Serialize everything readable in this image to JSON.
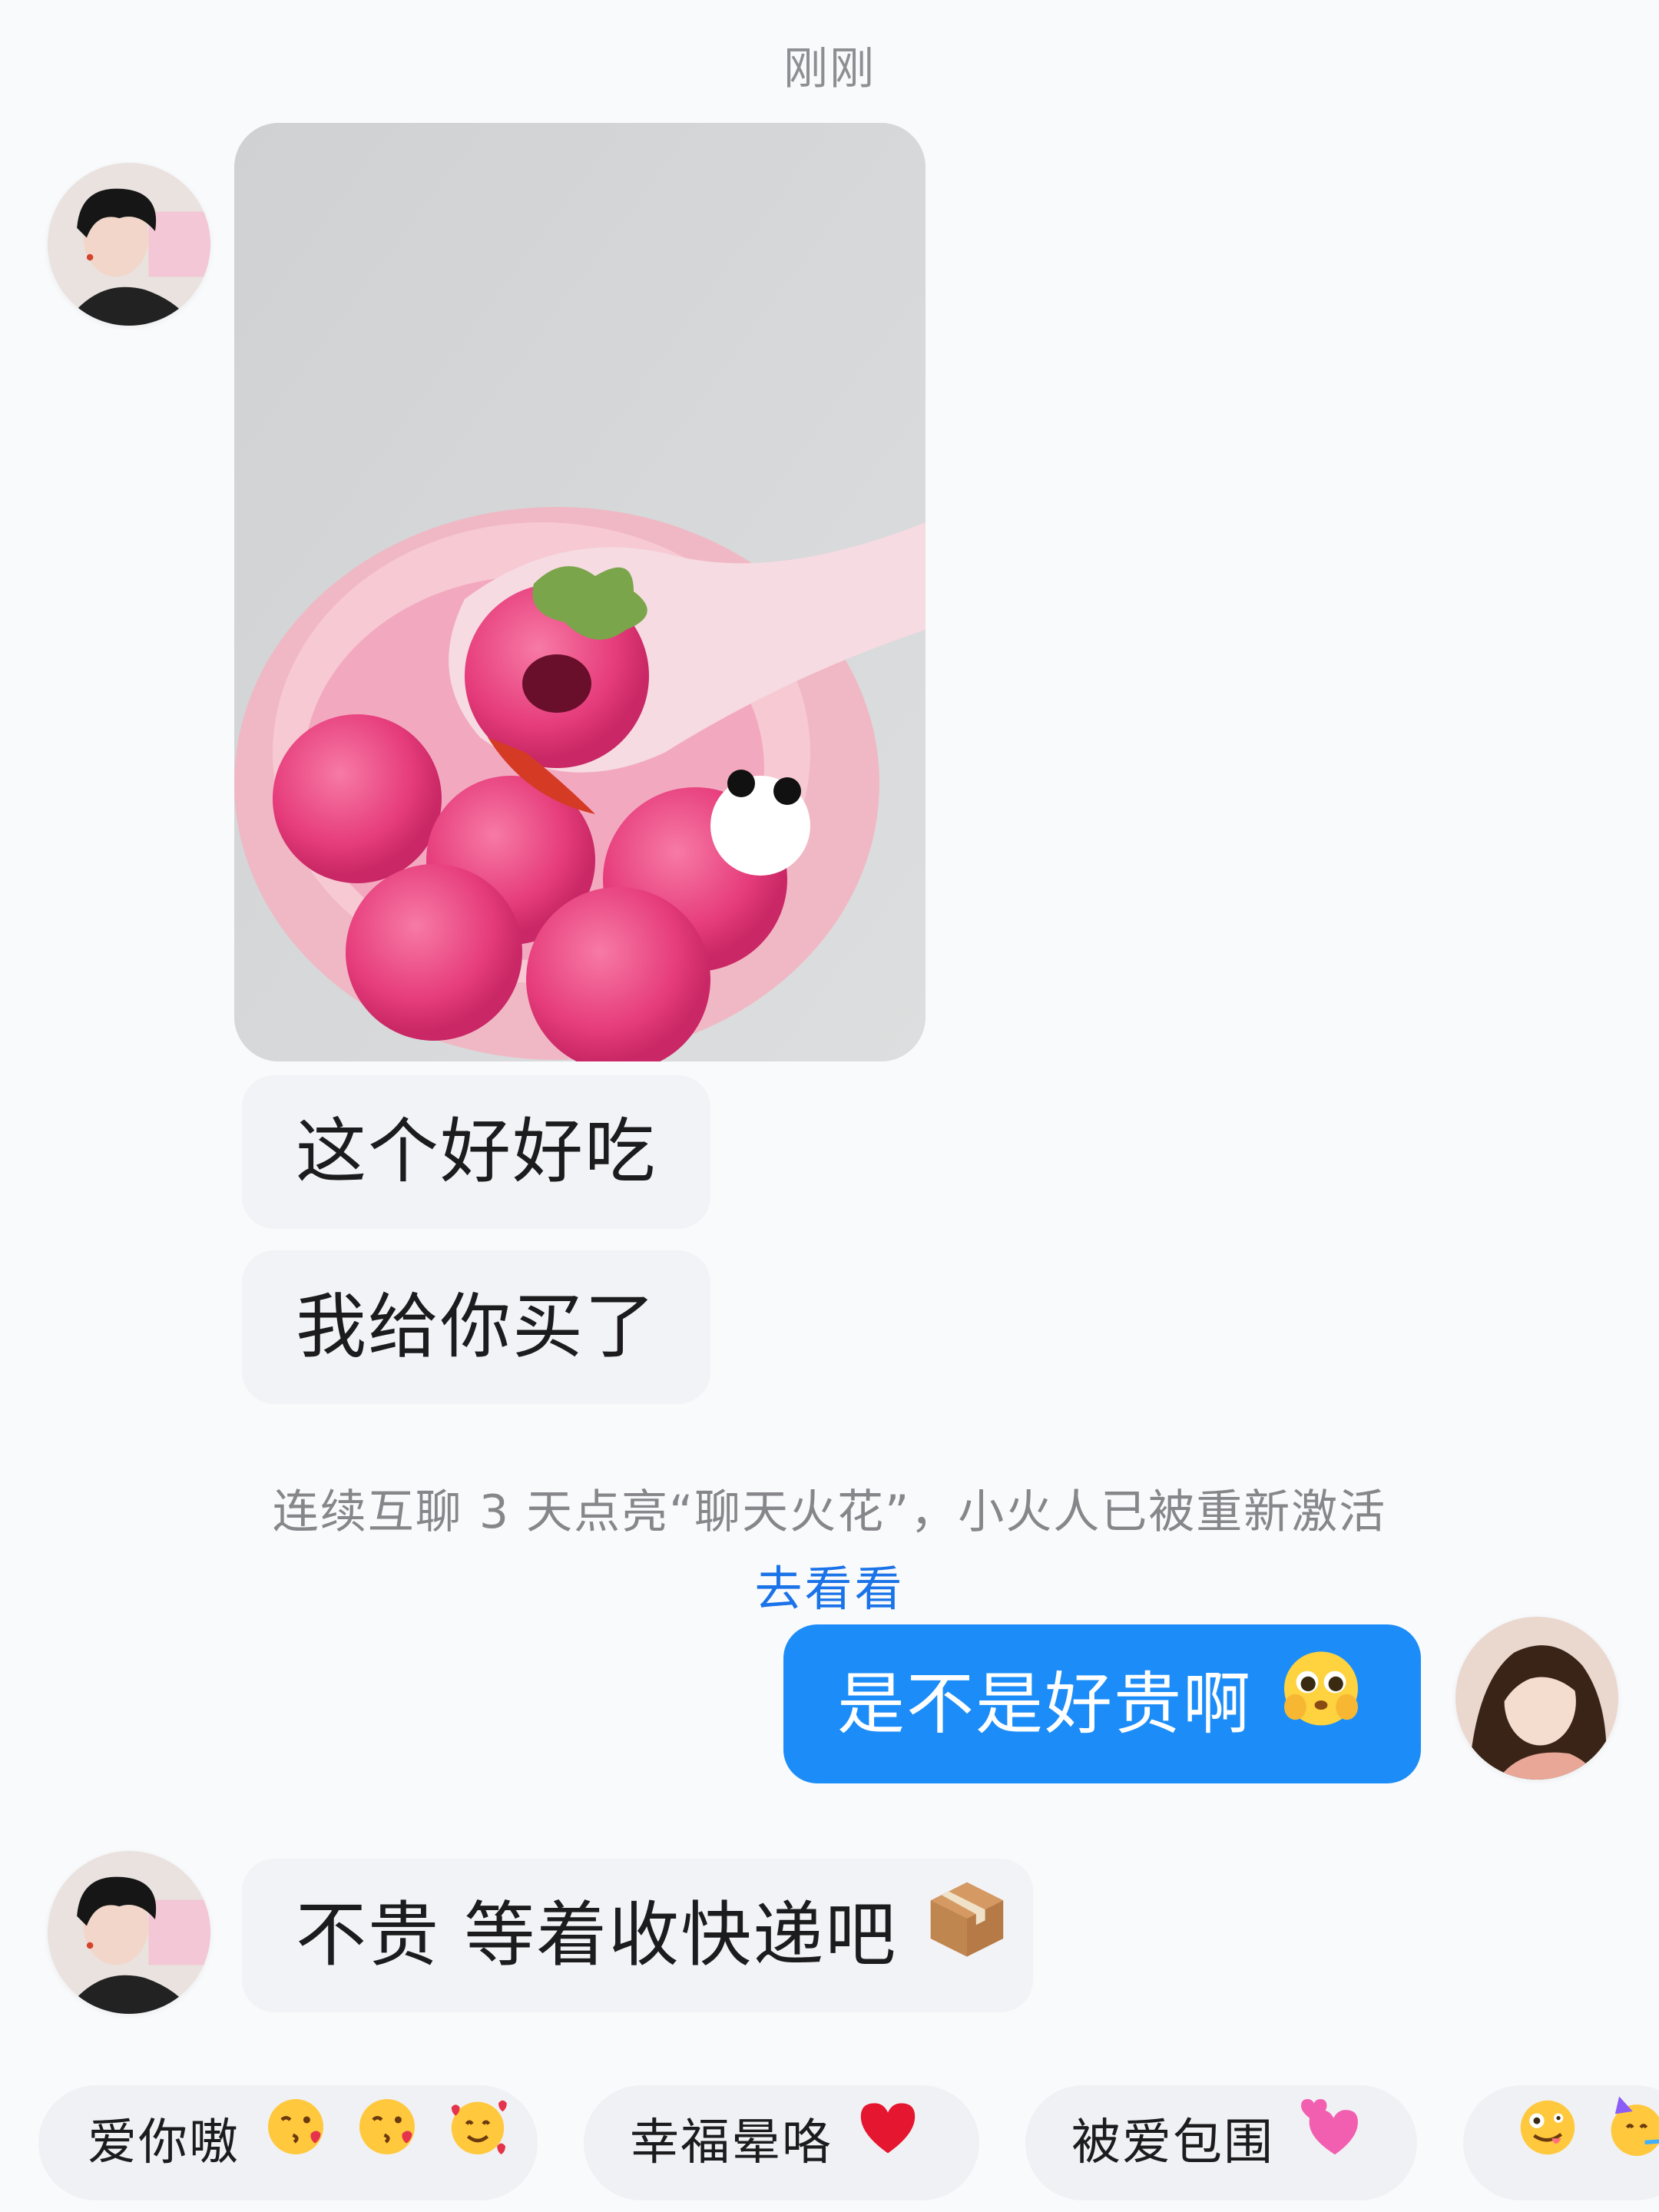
{
  "header": {
    "timestamp": "刚刚"
  },
  "messages": {
    "m1_text": "这个好好吃",
    "m2_text": "我给你买了",
    "m3_text": "是不是好贵啊",
    "m4_text": "不贵 等着收快递吧"
  },
  "system": {
    "notice": "连续互聊 3 天点亮“聊天火花”，小火人已被重新激活",
    "link": "去看看"
  },
  "quick_replies": [
    {
      "label": "爱你嗷"
    },
    {
      "label": "幸福晕咯"
    },
    {
      "label": "被爱包围"
    },
    {
      "label": ""
    }
  ],
  "colors": {
    "outgoing_bubble": "#1c8df8",
    "incoming_bubble": "#f2f3f6",
    "link": "#1a73e8"
  },
  "icons": [
    "pleading-face-icon",
    "package-icon",
    "kissing-face-icon",
    "smiling-hearts-icon",
    "red-heart-icon",
    "revolving-hearts-icon",
    "zany-face-icon",
    "partying-face-icon"
  ]
}
